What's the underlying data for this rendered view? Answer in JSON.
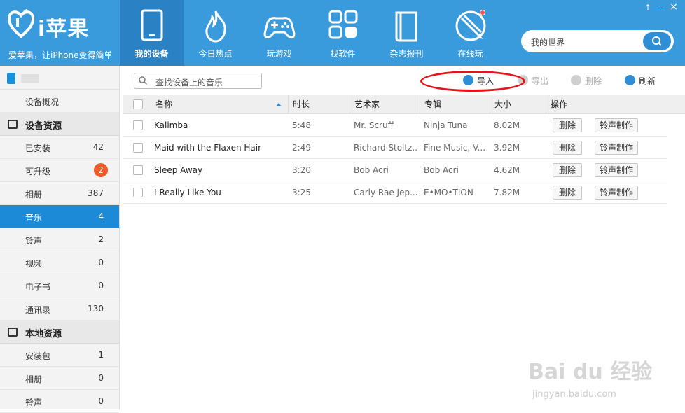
{
  "app": {
    "logo_text": "i苹果",
    "slogan": "爱苹果，让iPhone变得简单"
  },
  "nav": [
    {
      "label": "我的设备",
      "icon": "tablet-icon",
      "active": true
    },
    {
      "label": "今日热点",
      "icon": "flame-icon"
    },
    {
      "label": "玩游戏",
      "icon": "gamepad-icon"
    },
    {
      "label": "找软件",
      "icon": "apps-grid-icon"
    },
    {
      "label": "杂志报刊",
      "icon": "book-icon"
    },
    {
      "label": "在线玩",
      "icon": "pencil-icon",
      "notification": true
    }
  ],
  "window_controls": {
    "pin": "↑",
    "minimize": "—",
    "close": "×"
  },
  "top_search": {
    "text": "我的世界"
  },
  "sidebar": {
    "device_overview": "设备概况",
    "section_device": "设备资源",
    "device_items": [
      {
        "label": "已安装",
        "count": "42"
      },
      {
        "label": "可升级",
        "count": "2",
        "badge": true
      },
      {
        "label": "相册",
        "count": "387"
      },
      {
        "label": "音乐",
        "count": "4",
        "active": true
      },
      {
        "label": "铃声",
        "count": "2"
      },
      {
        "label": "视频",
        "count": "0"
      },
      {
        "label": "电子书",
        "count": "0"
      },
      {
        "label": "通讯录",
        "count": "130"
      }
    ],
    "section_local": "本地资源",
    "local_items": [
      {
        "label": "安装包",
        "count": "1"
      },
      {
        "label": "相册",
        "count": "0"
      },
      {
        "label": "铃声",
        "count": "0"
      }
    ]
  },
  "device_search": {
    "text": "查找设备上的音乐"
  },
  "toolbar": {
    "import": "导入",
    "export": "导出",
    "delete": "删除",
    "refresh": "刷新"
  },
  "table": {
    "headers": {
      "name": "名称",
      "duration": "时长",
      "artist": "艺术家",
      "album": "专辑",
      "size": "大小",
      "actions": "操作"
    },
    "rows": [
      {
        "name": "Kalimba",
        "duration": "5:48",
        "artist": "Mr. Scruff",
        "album": "Ninja Tuna",
        "size": "8.02M"
      },
      {
        "name": "Maid with the Flaxen Hair",
        "duration": "2:49",
        "artist": "Richard Stoltz...",
        "album": "Fine Music, V...",
        "size": "3.92M"
      },
      {
        "name": "Sleep Away",
        "duration": "3:20",
        "artist": "Bob Acri",
        "album": "Bob Acri",
        "size": "4.62M"
      },
      {
        "name": "I Really Like You",
        "duration": "3:25",
        "artist": "Carly Rae Jep...",
        "album": "E•MO•TION",
        "size": "7.82M"
      }
    ],
    "row_delete": "删除",
    "row_ringtone": "铃声制作"
  },
  "watermark": {
    "logo": "Bai du 经验",
    "url": "jingyan.baidu.com"
  },
  "colors": {
    "topbar": "#3a9bdc",
    "active_nav": "#2a82c4",
    "sidebar_active": "#1c8ad6",
    "badge": "#f05a28",
    "annotation": "#e8121a"
  }
}
